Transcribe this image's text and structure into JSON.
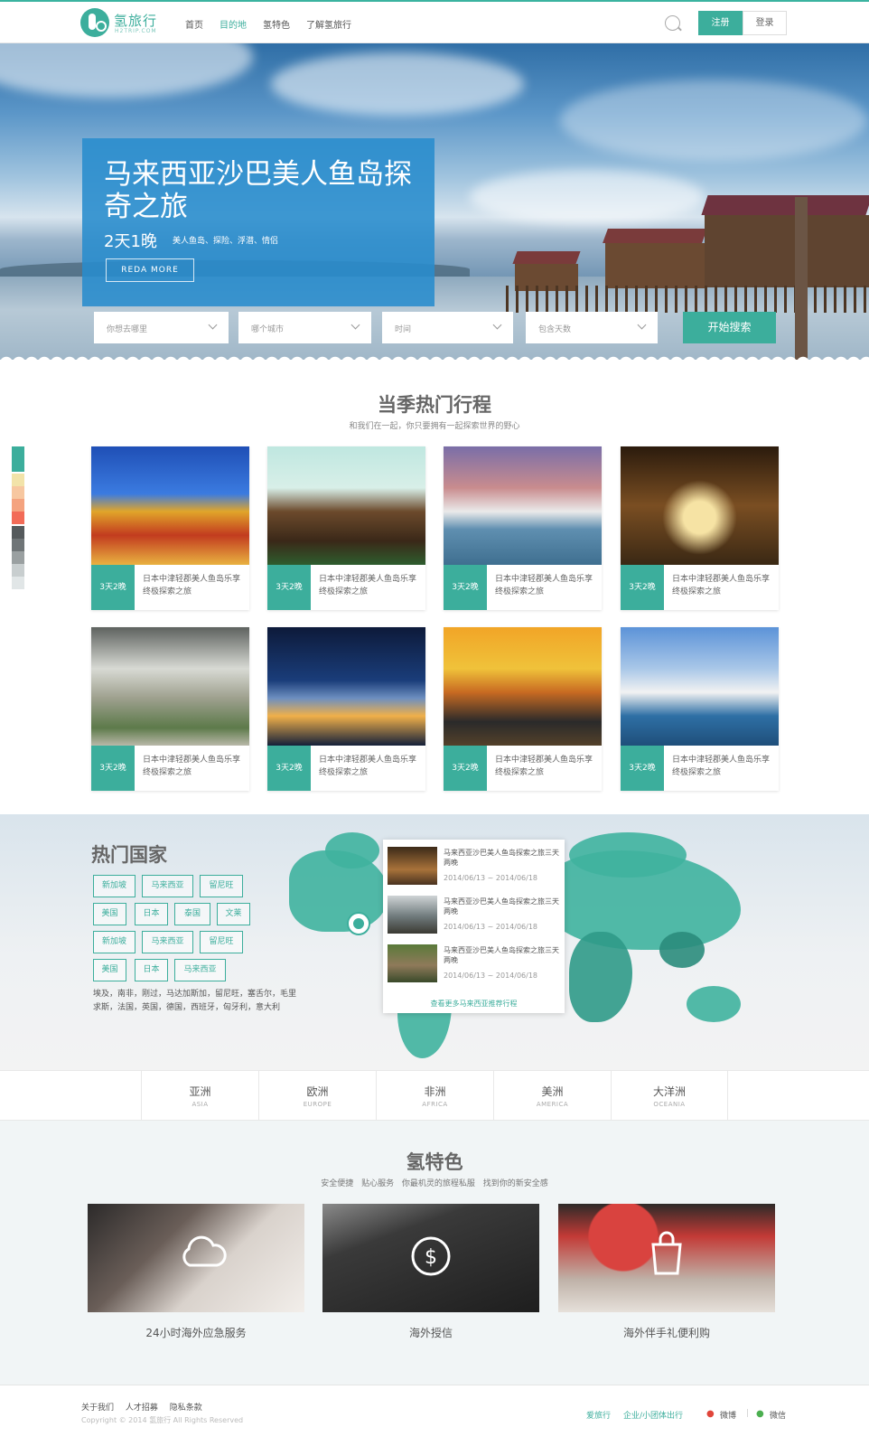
{
  "brand": {
    "name": "氢旅行",
    "sub": "H2TRIP.COM",
    "accent": "#3cae9c"
  },
  "nav": {
    "items": [
      "首页",
      "目的地",
      "氢特色",
      "了解氢旅行"
    ],
    "active_index": 1
  },
  "auth": {
    "register": "注册",
    "login": "登录"
  },
  "hero": {
    "title": "马来西亚沙巴美人鱼岛探奇之旅",
    "duration": "2天1晚",
    "tags": "美人鱼岛、探险、浮潜、情侣",
    "button": "REDA MORE",
    "search": {
      "where_placeholder": "你想去哪里",
      "city_placeholder": "哪个城市",
      "time_placeholder": "时间",
      "days_placeholder": "包含天数",
      "submit": "开始搜索"
    }
  },
  "trips": {
    "title": "当季热门行程",
    "subtitle": "和我们在一起，你只要拥有一起探索世界的野心",
    "palette": [
      "#3cae9c",
      "#3cae9c",
      "#f2e3a9",
      "#f7c7a0",
      "#f4a37f",
      "#f26b57",
      "#555a5c",
      "#6f7577",
      "#9aa0a1",
      "#c8cecf",
      "#e1e6e7"
    ],
    "cards": [
      {
        "badge": "3天2晚",
        "desc": "日本中津轻郡美人鱼岛乐享终极探索之旅"
      },
      {
        "badge": "3天2晚",
        "desc": "日本中津轻郡美人鱼岛乐享终极探索之旅"
      },
      {
        "badge": "3天2晚",
        "desc": "日本中津轻郡美人鱼岛乐享终极探索之旅"
      },
      {
        "badge": "3天2晚",
        "desc": "日本中津轻郡美人鱼岛乐享终极探索之旅"
      },
      {
        "badge": "3天2晚",
        "desc": "日本中津轻郡美人鱼岛乐享终极探索之旅"
      },
      {
        "badge": "3天2晚",
        "desc": "日本中津轻郡美人鱼岛乐享终极探索之旅"
      },
      {
        "badge": "3天2晚",
        "desc": "日本中津轻郡美人鱼岛乐享终极探索之旅"
      },
      {
        "badge": "3天2晚",
        "desc": "日本中津轻郡美人鱼岛乐享终极探索之旅"
      }
    ]
  },
  "countries": {
    "title": "热门国家",
    "tags": [
      "新加坡",
      "马来西亚",
      "留尼旺",
      "美国",
      "日本",
      "泰国",
      "文莱",
      "新加坡",
      "马来西亚",
      "留尼旺",
      "美国",
      "日本",
      "马来西亚"
    ],
    "list": "埃及，南非，刚过，马达加斯加，留尼旺，塞舌尔，毛里求斯，法国，英国，德国，西班牙，匈牙利，意大利",
    "popup": {
      "items": [
        {
          "title": "马来西亚沙巴美人鱼岛探索之旅三天两晚",
          "date": "2014/06/13 ~ 2014/06/18"
        },
        {
          "title": "马来西亚沙巴美人鱼岛探索之旅三天两晚",
          "date": "2014/06/13 ~ 2014/06/18"
        },
        {
          "title": "马来西亚沙巴美人鱼岛探索之旅三天两晚",
          "date": "2014/06/13 ~ 2014/06/18"
        }
      ],
      "more": "查看更多马来西亚推荐行程"
    },
    "continents": [
      {
        "cn": "亚洲",
        "en": "ASIA"
      },
      {
        "cn": "欧洲",
        "en": "EUROPE"
      },
      {
        "cn": "非洲",
        "en": "AFRICA"
      },
      {
        "cn": "美洲",
        "en": "AMERICA"
      },
      {
        "cn": "大洋洲",
        "en": "OCEANIA"
      }
    ]
  },
  "features": {
    "title": "氢特色",
    "subtitle": "安全便捷   贴心服务   你最机灵的旅程私服   找到你的新安全感",
    "items": [
      {
        "caption": "24小时海外应急服务"
      },
      {
        "caption": "海外授信"
      },
      {
        "caption": "海外伴手礼便利购"
      }
    ]
  },
  "footer": {
    "links": "关于我们   人才招募   隐私条款",
    "copyright": "Copyright © 2014 氢旅行 All Rights Reserved",
    "right1": "爱旅行",
    "right2": "企业/小团体出行",
    "weibo": "微博",
    "wechat": "微信"
  }
}
